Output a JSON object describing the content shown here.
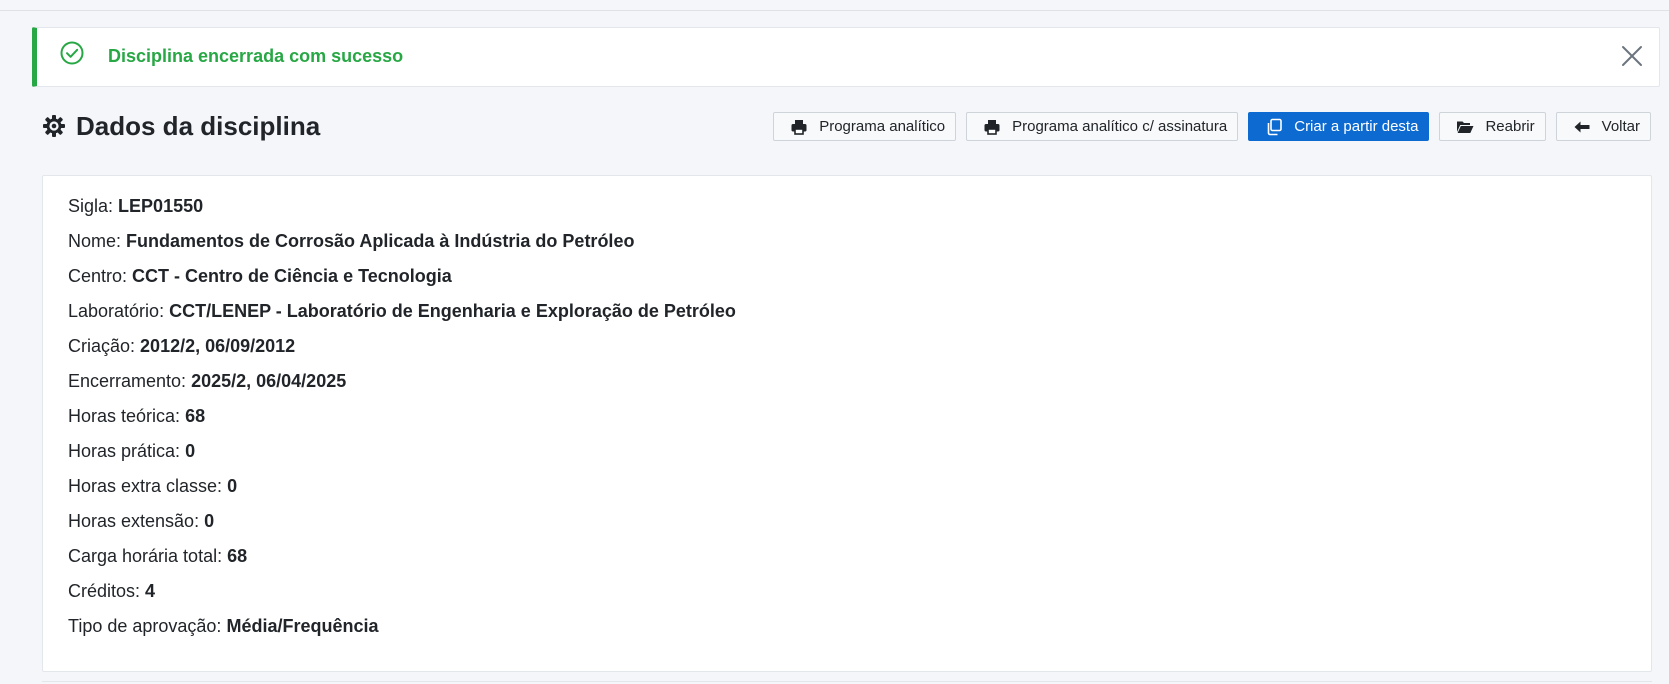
{
  "alert": {
    "message": "Disciplina encerrada com sucesso",
    "icon": "check-circle-icon",
    "color": "#28a745"
  },
  "page": {
    "title": "Dados da disciplina",
    "icon": "gear-icon"
  },
  "toolbar": {
    "buttons": [
      {
        "label": "Programa analítico",
        "icon": "printer-icon"
      },
      {
        "label": "Programa analítico c/ assinatura",
        "icon": "printer-icon"
      },
      {
        "label": "Criar a partir desta",
        "icon": "copy-icon"
      },
      {
        "label": "Reabrir",
        "icon": "folder-open-icon"
      },
      {
        "label": "Voltar",
        "icon": "arrow-left-icon"
      }
    ],
    "primary_color": "#0d6ad1"
  },
  "details": [
    {
      "label": "Sigla:",
      "value": "LEP01550"
    },
    {
      "label": "Nome:",
      "value": "Fundamentos de Corrosão Aplicada à Indústria do Petróleo"
    },
    {
      "label": "Centro:",
      "value": "CCT - Centro de Ciência e Tecnologia"
    },
    {
      "label": "Laboratório:",
      "value": "CCT/LENEP - Laboratório de Engenharia e Exploração de Petróleo"
    },
    {
      "label": "Criação:",
      "value": "2012/2, 06/09/2012"
    },
    {
      "label": "Encerramento:",
      "value": "2025/2, 06/04/2025"
    },
    {
      "label": "Horas teórica:",
      "value": "68"
    },
    {
      "label": "Horas prática:",
      "value": "0"
    },
    {
      "label": "Horas extra classe:",
      "value": "0"
    },
    {
      "label": "Horas extensão:",
      "value": "0"
    },
    {
      "label": "Carga horária total:",
      "value": "68"
    },
    {
      "label": "Créditos:",
      "value": "4"
    },
    {
      "label": "Tipo de aprovação:",
      "value": "Média/Frequência"
    }
  ]
}
